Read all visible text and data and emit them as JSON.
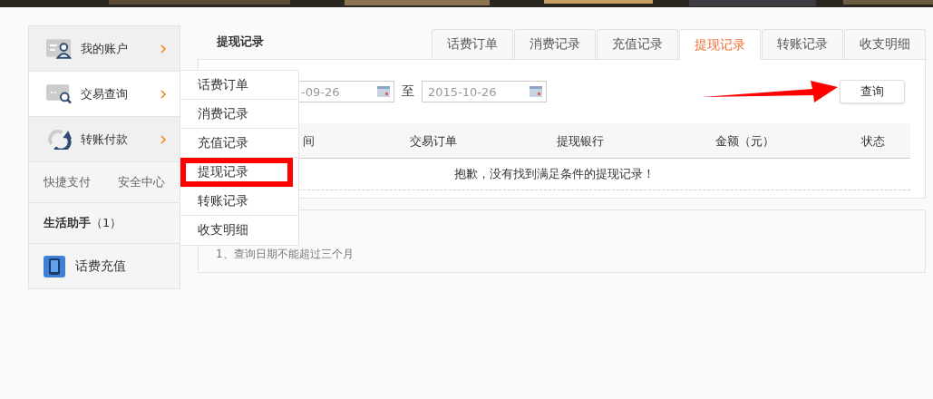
{
  "banner": {
    "kind": "picture"
  },
  "sidebar": {
    "items": [
      {
        "label": "我的账户",
        "selected": false
      },
      {
        "label": "交易查询",
        "selected": true
      },
      {
        "label": "转账付款",
        "selected": false
      }
    ],
    "links": [
      "快捷支付",
      "安全中心"
    ],
    "section_title": "生活助手",
    "section_count": "（1）",
    "apps": [
      {
        "label": "话费充值"
      }
    ]
  },
  "dropdown": {
    "items": [
      {
        "label": "话费订单",
        "selected": false
      },
      {
        "label": "消费记录",
        "selected": false
      },
      {
        "label": "充值记录",
        "selected": false
      },
      {
        "label": "提现记录",
        "selected": true
      },
      {
        "label": "转账记录",
        "selected": false
      },
      {
        "label": "收支明细",
        "selected": false
      }
    ]
  },
  "page_title": "提现记录",
  "tabs": [
    {
      "label": "话费订单",
      "selected": false
    },
    {
      "label": "消费记录",
      "selected": false
    },
    {
      "label": "充值记录",
      "selected": false
    },
    {
      "label": "提现记录",
      "selected": true
    },
    {
      "label": "转账记录",
      "selected": false
    },
    {
      "label": "收支明细",
      "selected": false
    }
  ],
  "filter": {
    "start_date": "-09-26",
    "separator": "至",
    "end_date": "2015-10-26",
    "button": "查询"
  },
  "table": {
    "columns": [
      "间",
      "交易订单",
      "提现银行",
      "金额（元）",
      "状态"
    ],
    "empty_message": "抱歉，没有找到满足条件的提现记录！"
  },
  "notes": [
    "1、查询日期不能超过三个月"
  ]
}
